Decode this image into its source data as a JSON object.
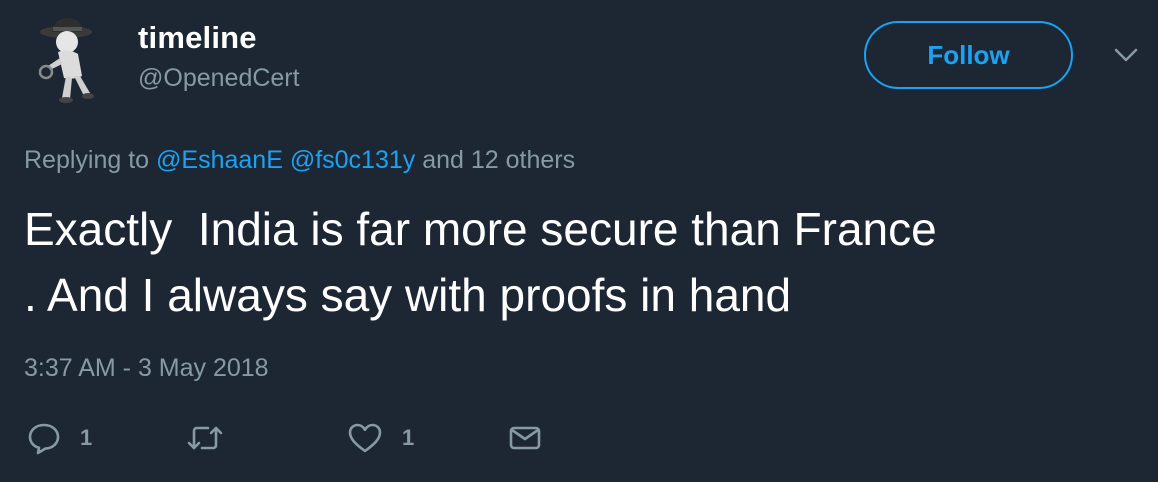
{
  "author": {
    "display_name": "timeline",
    "handle": "@OpenedCert",
    "avatar_icon": "detective-figure-avatar"
  },
  "follow_button": {
    "label": "Follow"
  },
  "menu_icon": "chevron-down-icon",
  "reply_context": {
    "prefix": "Replying to ",
    "mentions": [
      "@EshaanE",
      "@fs0c131y"
    ],
    "suffix": "and 12 others"
  },
  "tweet": {
    "text": "Exactly  India is far more secure than France\n. And I always say with proofs in hand",
    "timestamp": "3:37 AM - 3 May 2018"
  },
  "actions": {
    "reply": {
      "icon": "reply-icon",
      "count": "1"
    },
    "retweet": {
      "icon": "retweet-icon",
      "count": ""
    },
    "like": {
      "icon": "heart-icon",
      "count": "1"
    },
    "message": {
      "icon": "envelope-icon"
    }
  },
  "colors": {
    "background": "#1c2733",
    "accent": "#1da1f2",
    "secondary_text": "#8899a6",
    "primary_text": "#ffffff"
  }
}
